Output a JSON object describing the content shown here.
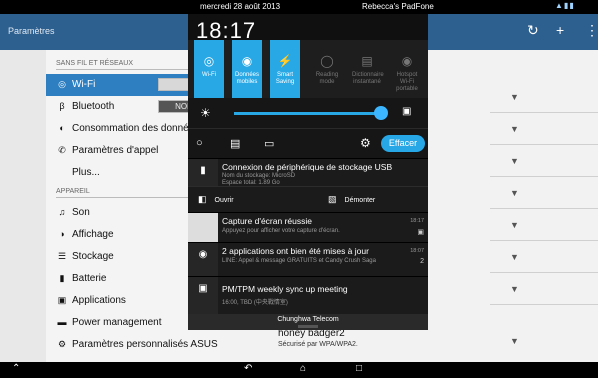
{
  "status_bar": {
    "date": "mercredi 28 août 2013",
    "device": "Rebecca's PadFone",
    "icons": "wifi signal battery"
  },
  "action_bar": {
    "title": "Paramètres",
    "icons": [
      "wifi-refresh-icon",
      "add-icon",
      "overflow-menu-icon"
    ]
  },
  "settings": {
    "section_wireless": "SANS FIL ET RÉSEAUX",
    "section_device": "APPAREIL",
    "items": [
      {
        "icon": "wifi-icon",
        "label": "Wi-Fi",
        "selected": true
      },
      {
        "icon": "bluetooth-icon",
        "label": "Bluetooth",
        "toggle": "NON"
      },
      {
        "icon": "data-usage-icon",
        "label": "Consommation des données"
      },
      {
        "icon": "phone-icon",
        "label": "Paramètres d'appel"
      },
      {
        "icon": "",
        "label": "Plus..."
      },
      {
        "icon": "sound-icon",
        "label": "Son"
      },
      {
        "icon": "display-icon",
        "label": "Affichage"
      },
      {
        "icon": "storage-icon",
        "label": "Stockage"
      },
      {
        "icon": "battery-icon",
        "label": "Batterie"
      },
      {
        "icon": "apps-icon",
        "label": "Applications"
      },
      {
        "icon": "power-icon",
        "label": "Power management"
      },
      {
        "icon": "asus-settings-icon",
        "label": "Paramètres personnalisés ASUS"
      }
    ]
  },
  "wifi_network": {
    "name": "honey badger2",
    "security": "Sécurisé par WPA/WPA2."
  },
  "shade": {
    "clock": "18:17",
    "tiles": [
      {
        "label": "Wi-Fi",
        "on": true,
        "icon": "wifi-icon"
      },
      {
        "label": "Données mobiles",
        "on": true,
        "icon": "mobile-data-icon"
      },
      {
        "label": "Smart Saving",
        "on": true,
        "icon": "smart-saving-icon"
      },
      {
        "label": "Reading mode",
        "on": false,
        "icon": "reading-icon"
      },
      {
        "label": "Dictionnaire instantané",
        "on": false,
        "icon": "dictionary-icon"
      },
      {
        "label": "Hotspot Wi-Fi portable",
        "on": false,
        "icon": "hotspot-icon"
      }
    ],
    "brightness_level": 0.97,
    "brightness_auto": "AUTO",
    "clear_label": "Effacer",
    "notifications": [
      {
        "icon": "sd-card-icon",
        "title": "Connexion de périphérique de stockage USB",
        "lines": [
          "Nom du stockage: MicroSD",
          "Espace total: 1.89 Go"
        ],
        "time": ""
      },
      {
        "icon": "screenshot-thumb-icon",
        "title": "Capture d'écran réussie",
        "lines": [
          "Appuyez pour afficher votre capture d'écran."
        ],
        "time": "18:17"
      },
      {
        "icon": "update-icon",
        "title": "2 applications ont bien été mises à jour",
        "lines": [
          "LINE: Appel & message GRATUITS et Candy Crush Saga"
        ],
        "time": "18:07",
        "count": "2"
      },
      {
        "icon": "calendar-icon",
        "title": "PM/TPM weekly sync up meeting",
        "lines": [
          "16:00, TBD (中央戰情室)"
        ],
        "time": ""
      }
    ],
    "actions": {
      "open": "Ouvrir",
      "unmount": "Démonter"
    },
    "carrier": "Chunghwa Telecom"
  }
}
